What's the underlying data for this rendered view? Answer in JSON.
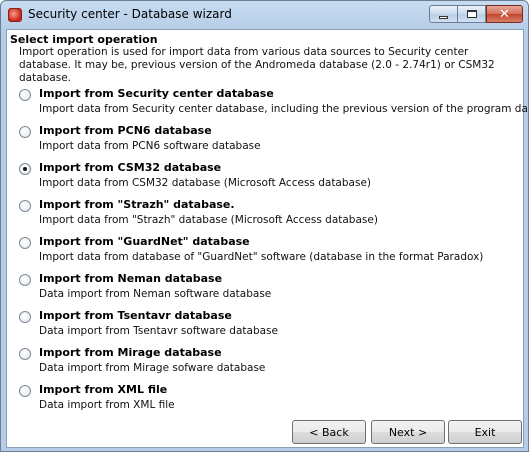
{
  "window": {
    "title": "Security center - Database wizard"
  },
  "header": {
    "title": "Select import operation",
    "description": "Import operation is used for import data from various data sources to Security center database. It may be, previous version of the Andromeda database (2.0 - 2.74r1) or CSM32 database."
  },
  "options": [
    {
      "title": "Import from Security center database",
      "description": "Import data from Security center database, including the previous version of the program database.",
      "selected": false
    },
    {
      "title": "Import from PCN6 database",
      "description": "Import data from PCN6 software database",
      "selected": false
    },
    {
      "title": "Import from CSM32 database",
      "description": "Import data from CSM32 database (Microsoft Access database)",
      "selected": true
    },
    {
      "title": "Import from \"Strazh\" database.",
      "description": "Import data from \"Strazh\" database (Microsoft Access database)",
      "selected": false
    },
    {
      "title": "Import from \"GuardNet\" database",
      "description": "Import data from database of \"GuardNet\" software (database in the format Paradox)",
      "selected": false
    },
    {
      "title": "Import from Neman database",
      "description": "Data import from Neman software database",
      "selected": false
    },
    {
      "title": "Import from Tsentavr database",
      "description": "Data import from Tsentavr software database",
      "selected": false
    },
    {
      "title": "Import from Mirage database",
      "description": "Data import from Mirage sofware database",
      "selected": false
    },
    {
      "title": "Import from XML file",
      "description": "Data import from XML file",
      "selected": false
    }
  ],
  "buttons": {
    "back": "< Back",
    "next": "Next >",
    "exit": "Exit"
  },
  "icons": {
    "app": "app-icon",
    "minimize": "minimize-icon",
    "maximize": "maximize-icon",
    "close": "close-icon"
  },
  "colors": {
    "titlebar": "#b6cde7",
    "close_button": "#c2452b",
    "client_background": "#ffffff"
  }
}
